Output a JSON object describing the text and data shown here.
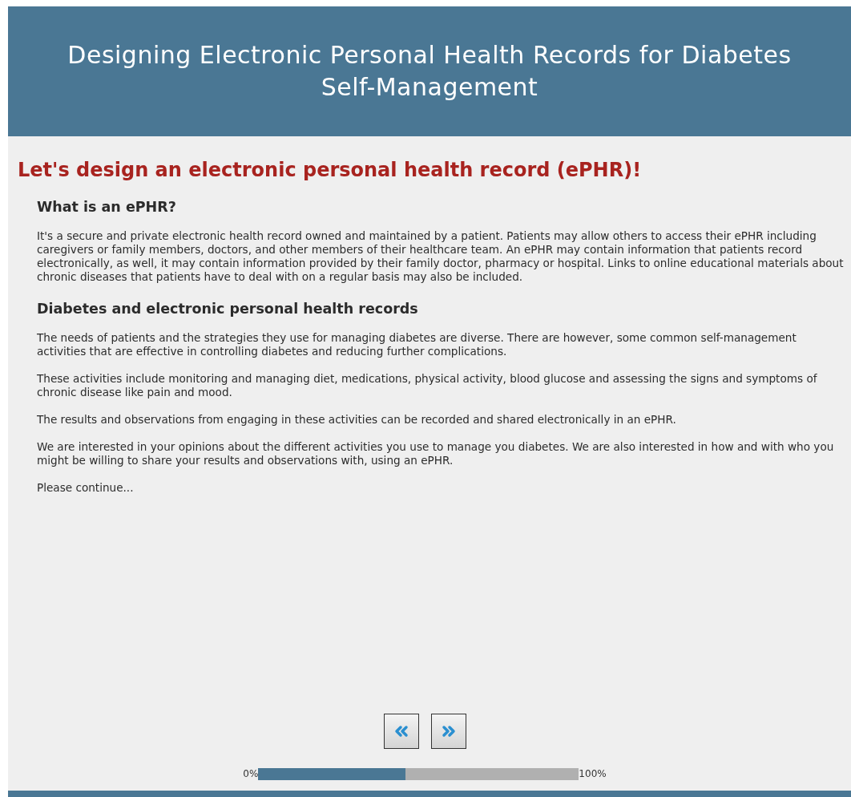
{
  "header": {
    "title": "Designing Electronic Personal Health Records for Diabetes Self-Management"
  },
  "page_heading": "Let's design an electronic personal health record (ePHR)!",
  "sections": [
    {
      "kind": "heading",
      "text": "What is an ePHR?"
    },
    {
      "kind": "paragraph",
      "text": "It's a secure and private electronic health record owned and maintained by a patient. Patients may allow others to access their ePHR including caregivers or family members, doctors, and other members of their healthcare team. An ePHR may contain information that patients record electronically, as well, it may contain information provided by their family doctor, pharmacy or hospital. Links to online educational materials about chronic diseases that patients have to deal with on a regular basis may also be included."
    },
    {
      "kind": "heading",
      "text": "Diabetes and electronic personal health records"
    },
    {
      "kind": "paragraph",
      "text": "The needs of patients and the strategies they use for managing diabetes are diverse. There are however, some common self-management activities that are effective in controlling diabetes and reducing further complications."
    },
    {
      "kind": "paragraph",
      "text": "These activities include monitoring and managing diet, medications, physical activity, blood glucose and assessing the signs and symptoms of chronic disease like pain and mood."
    },
    {
      "kind": "paragraph",
      "text": "The results and observations from engaging in these activities can be recorded and shared electronically in an ePHR."
    },
    {
      "kind": "paragraph",
      "text": "We are interested in your opinions about the different activities you use to manage you diabetes. We are also interested in how and with who you might be willing to share your results and observations with, using an ePHR."
    },
    {
      "kind": "paragraph",
      "text": "Please continue..."
    }
  ],
  "navigation": [
    {
      "kind": "back"
    },
    {
      "kind": "next"
    }
  ],
  "progress": {
    "start_label": "0%",
    "end_label": "100%",
    "level": 0.46
  }
}
